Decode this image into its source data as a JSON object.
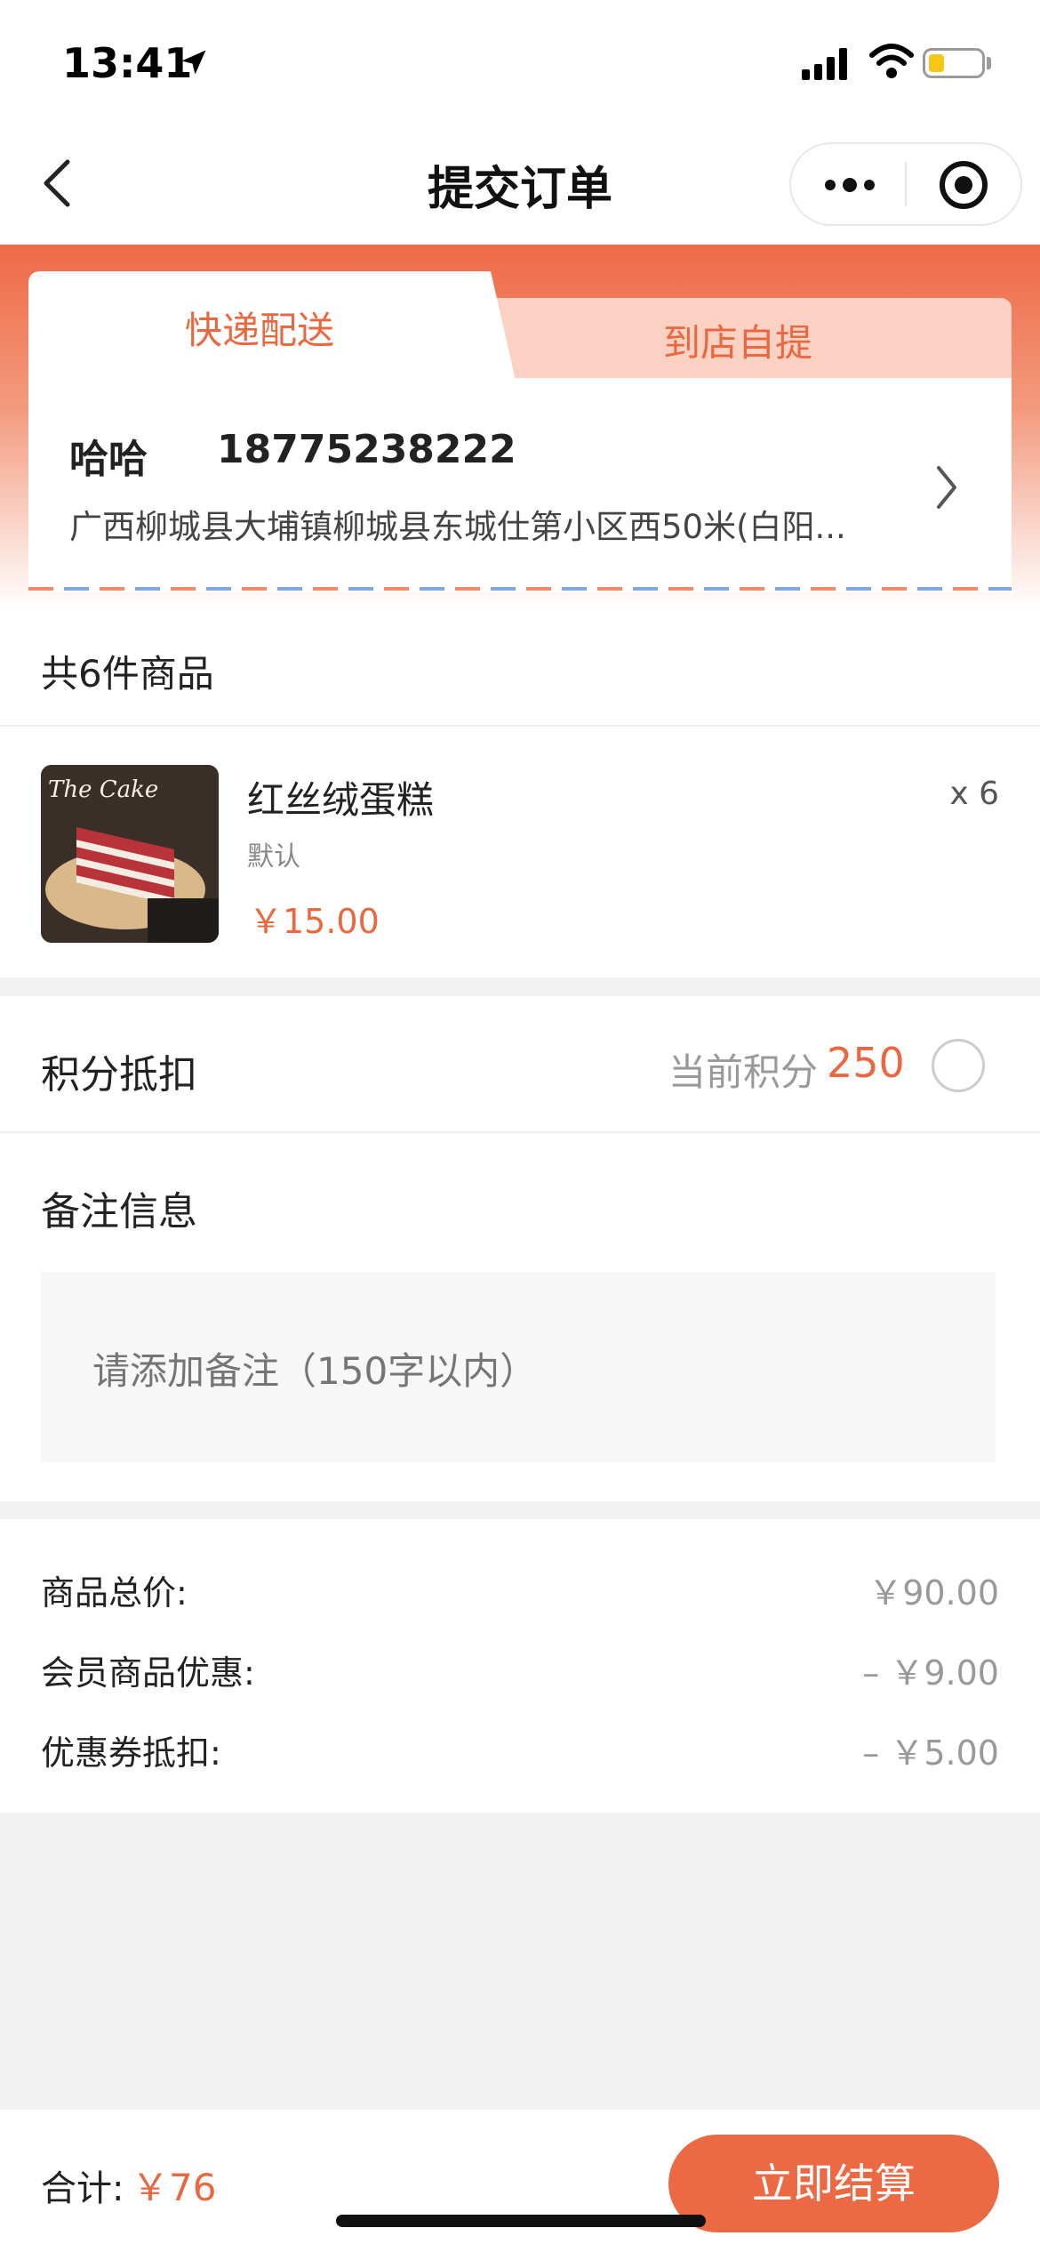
{
  "status_bar": {
    "time": "13:41",
    "battery_level": 0.3
  },
  "nav": {
    "title": "提交订单"
  },
  "delivery_tabs": {
    "active": "快递配送",
    "inactive": "到店自提"
  },
  "address": {
    "name": "哈哈",
    "phone": "18775238222",
    "detail": "广西柳城县大埔镇柳城县东城仕第小区西50米(白阳..."
  },
  "goods": {
    "count_label": "共6件商品",
    "items": [
      {
        "name": "红丝绒蛋糕",
        "spec": "默认",
        "price": "￥15.00",
        "qty": "x 6",
        "image_text": "The Cake"
      }
    ]
  },
  "points": {
    "label": "积分抵扣",
    "current_label": "当前积分",
    "value": "250",
    "checked": false
  },
  "remark": {
    "label": "备注信息",
    "placeholder": "请添加备注（150字以内）"
  },
  "totals": [
    {
      "label": "商品总价:",
      "value": "￥90.00"
    },
    {
      "label": "会员商品优惠:",
      "value": "– ￥9.00"
    },
    {
      "label": "优惠券抵扣:",
      "value": "– ￥5.00"
    }
  ],
  "footer": {
    "sum_label": "合计:",
    "sum_value": "￥76",
    "pay_label": "立即结算"
  },
  "colors": {
    "accent": "#ec6a43",
    "tab_inactive_bg": "#fbd1c4",
    "page_bg": "#f2f2f2"
  }
}
